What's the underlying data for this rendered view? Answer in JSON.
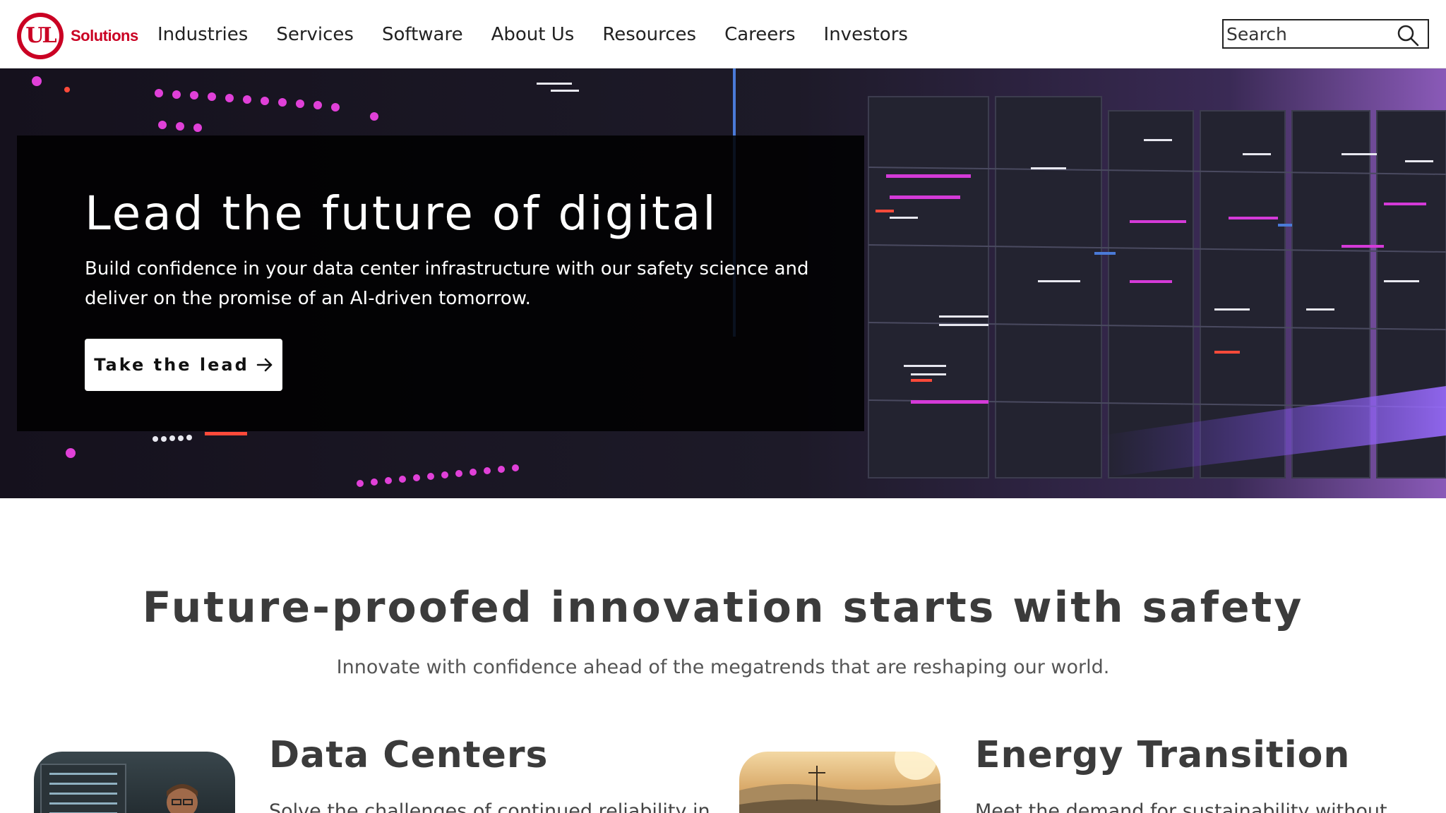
{
  "header": {
    "logo_mark": "UL",
    "logo_text": "Solutions",
    "brand_color": "#ca0123",
    "nav": [
      {
        "label": "Industries"
      },
      {
        "label": "Services"
      },
      {
        "label": "Software"
      },
      {
        "label": "About Us"
      },
      {
        "label": "Resources"
      },
      {
        "label": "Careers"
      },
      {
        "label": "Investors"
      }
    ],
    "search": {
      "placeholder": "Search",
      "icon": "search-icon"
    }
  },
  "hero": {
    "title": "Lead the future of digital",
    "description": "Build confidence in your data center infrastructure with our safety science and deliver on the promise of an AI-driven tomorrow.",
    "cta_label": "Take the lead",
    "cta_icon": "arrow-right-icon"
  },
  "intro": {
    "title": "Future-proofed innovation starts with safety",
    "subtitle": "Innovate with confidence ahead of the megatrends that are reshaping our world."
  },
  "cards": [
    {
      "title": "Data Centers",
      "text": "Solve the challenges of continued reliability in"
    },
    {
      "title": "Energy Transition",
      "text": "Meet the demand for sustainability without"
    }
  ]
}
